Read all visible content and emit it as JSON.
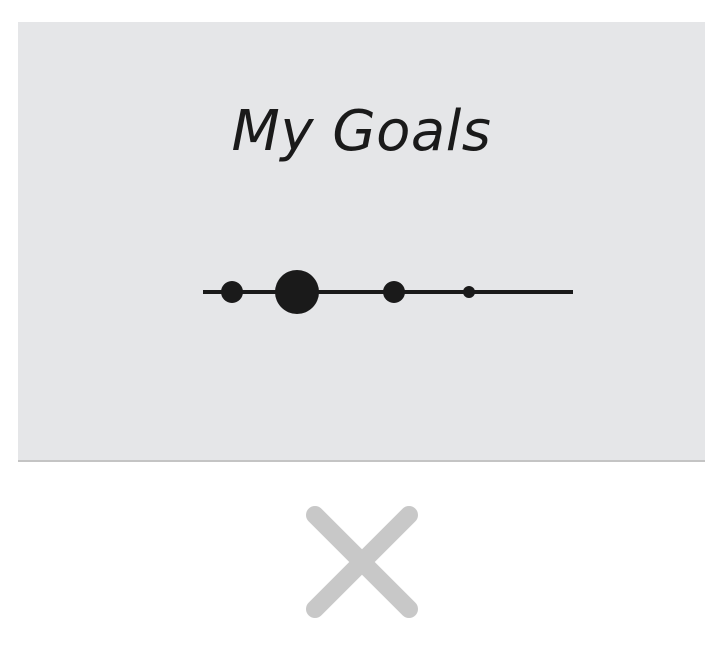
{
  "goals_card": {
    "title": "My Goals",
    "background_color": "#e5e6e8"
  },
  "progress_indicator": {
    "steps_total": 4,
    "current_step": 2
  },
  "close_button": {
    "icon": "close-icon",
    "icon_color": "#c8c8c8"
  }
}
